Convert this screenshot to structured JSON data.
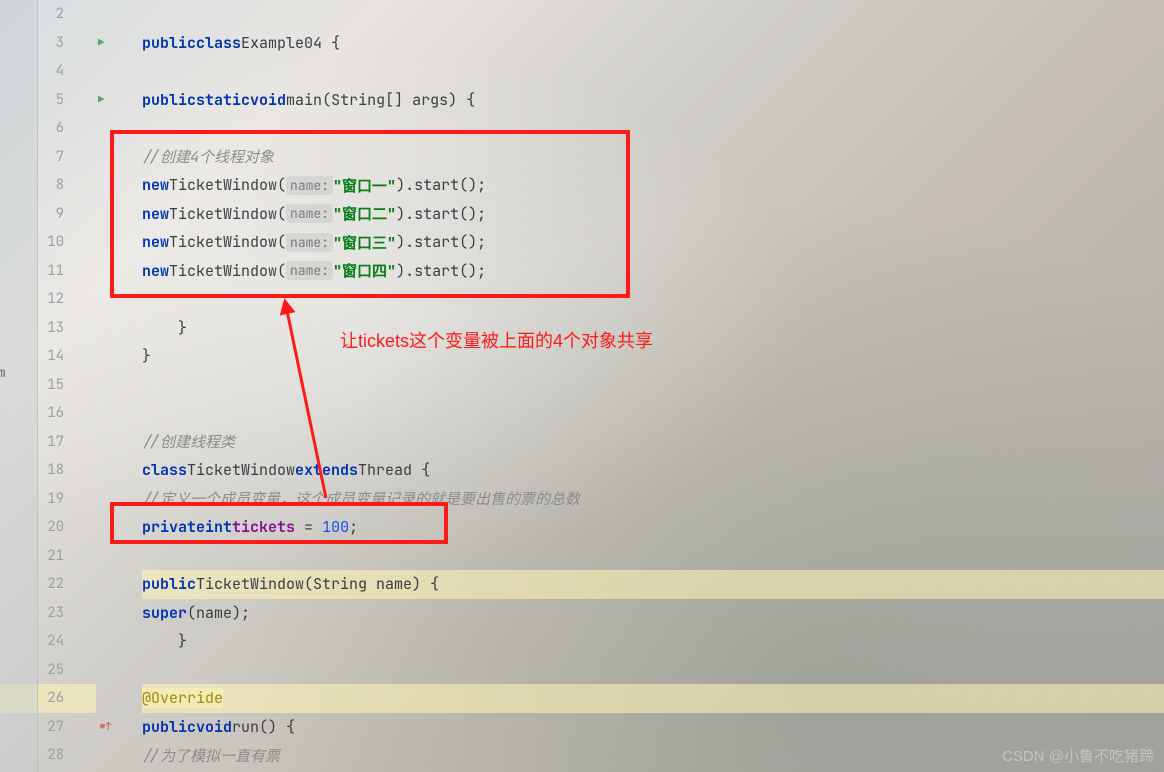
{
  "lines": {
    "start": 2,
    "end": 28
  },
  "code": {
    "l3": {
      "public": "public",
      "class": "class",
      "name": "Example04"
    },
    "l5": {
      "public": "public",
      "static": "static",
      "void": "void",
      "main": "main",
      "args": "(String[] args) {"
    },
    "l7": {
      "comment": "//创建4个线程对象"
    },
    "l8": {
      "new": "new",
      "cls": "TicketWindow(",
      "hint": "name:",
      "str": "\"窗口一\"",
      "tail": ").start();"
    },
    "l9": {
      "new": "new",
      "cls": "TicketWindow(",
      "hint": "name:",
      "str": "\"窗口二\"",
      "tail": ").start();"
    },
    "l10": {
      "new": "new",
      "cls": "TicketWindow(",
      "hint": "name:",
      "str": "\"窗口三\"",
      "tail": ").start();"
    },
    "l11": {
      "new": "new",
      "cls": "TicketWindow(",
      "hint": "name:",
      "str": "\"窗口四\"",
      "tail": ").start();"
    },
    "l17": {
      "comment": "//创建线程类"
    },
    "l18": {
      "class": "class",
      "name": "TicketWindow",
      "extends": "extends",
      "parent": "Thread"
    },
    "l19": {
      "comment": "//定义一个成员变量，这个成员变量记录的就是要出售的票的总数"
    },
    "l20": {
      "private": "private",
      "int": "int",
      "field": "tickets",
      "eq": " = ",
      "num": "100"
    },
    "l22": {
      "public": "public",
      "name": "TicketWindow",
      "args": "(String name) {"
    },
    "l23": {
      "super": "super",
      "args": "(name);"
    },
    "l26": {
      "anno": "@Override"
    },
    "l27": {
      "public": "public",
      "void": "void",
      "run": "run",
      "args": "() {"
    },
    "l28": {
      "comment": "//为了模拟一直有票"
    }
  },
  "annotation": "让tickets这个变量被上面的4个对象共享",
  "left_cut": "em",
  "watermark": "CSDN @小鲁不吃猪蹄"
}
